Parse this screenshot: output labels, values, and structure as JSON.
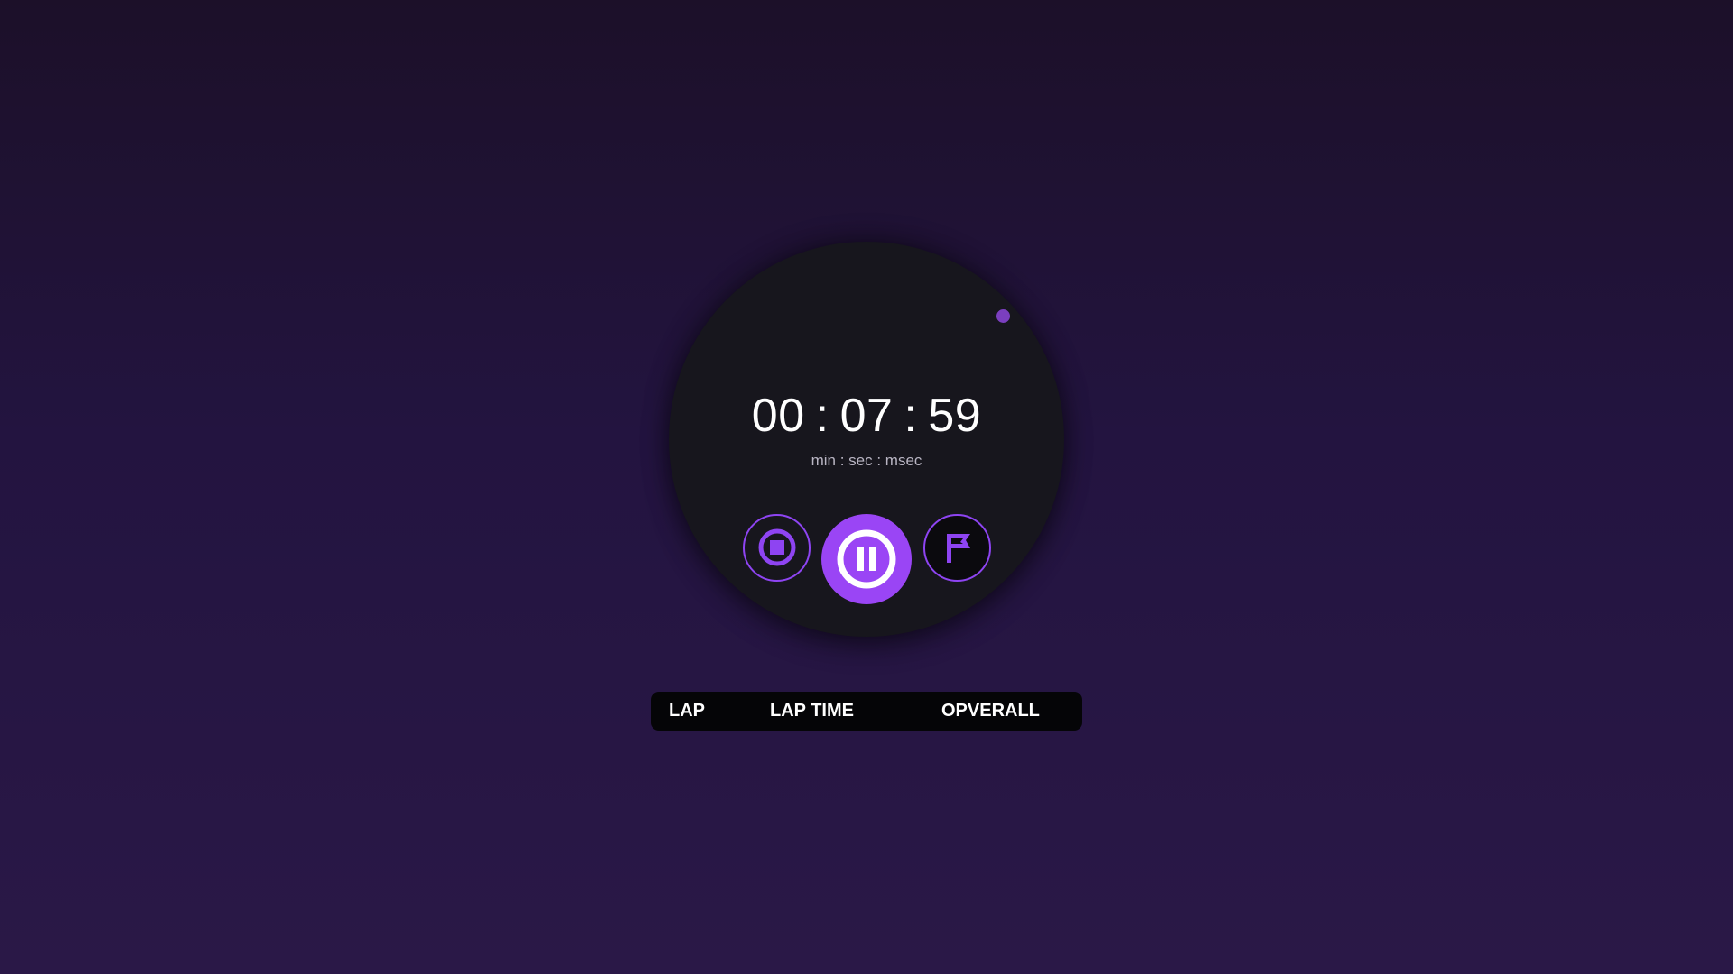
{
  "timer": {
    "minutes": "00",
    "seconds": "07",
    "milliseconds": "59",
    "separator": ":",
    "units_label": "min : sec : msec"
  },
  "controls": {
    "stop_icon": "stop-icon",
    "pause_icon": "pause-icon",
    "lap_icon": "flag-icon"
  },
  "lap_table": {
    "columns": [
      "LAP",
      "LAP TIME",
      "OPVERALL"
    ]
  },
  "colors": {
    "accent": "#9a45f5",
    "dial": "#17161d",
    "background_top": "#1c1029",
    "background_bottom": "#2a1847"
  }
}
